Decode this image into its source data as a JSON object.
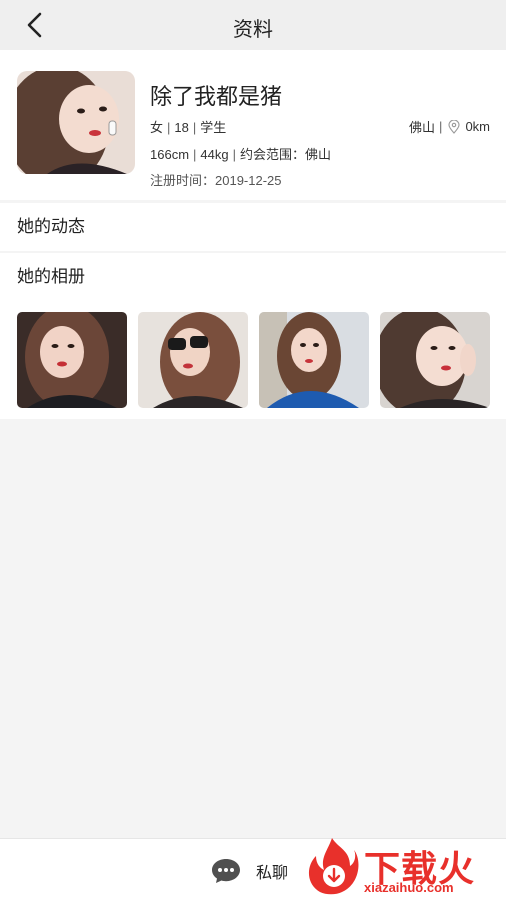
{
  "header": {
    "title": "资料"
  },
  "profile": {
    "name": "除了我都是猪",
    "gender": "女",
    "age": "18",
    "occupation": "学生",
    "city": "佛山",
    "distance": "0km",
    "height": "166cm",
    "weight": "44kg",
    "date_range_label": "约会范围：",
    "date_range": "佛山",
    "register_label": "注册时间：",
    "register_date": "2019-12-25"
  },
  "menu": {
    "moments": "她的动态",
    "album": "她的相册"
  },
  "album": {
    "photo_count": 4
  },
  "footer": {
    "chat_label": "私聊"
  },
  "watermark": {
    "brand": "下载火",
    "url": "xiazaihuo.com"
  },
  "colors": {
    "accent": "#e8302b",
    "nav_bg": "#efefef",
    "page_bg": "#f4f4f4"
  }
}
